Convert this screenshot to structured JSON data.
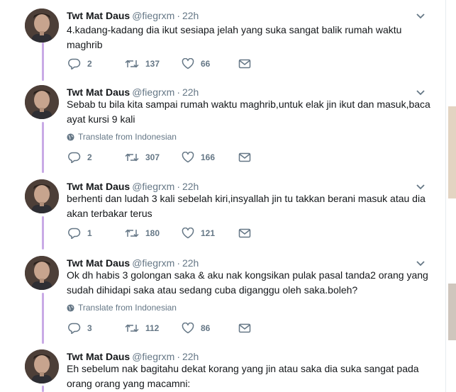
{
  "tweets": [
    {
      "name": "Twt Mat Daus",
      "handle": "@fiegrxm",
      "time": "22h",
      "dot": "·",
      "text": "4.kadang-kadang dia ikut sesiapa jelah yang suka sangat balik rumah waktu maghrib",
      "translate": "",
      "replies": "2",
      "retweets": "137",
      "likes": "66"
    },
    {
      "name": "Twt Mat Daus",
      "handle": "@fiegrxm",
      "time": "22h",
      "dot": "·",
      "text": "Sebab tu bila kita sampai rumah waktu maghrib,untuk elak jin ikut dan masuk,baca ayat kursi 9 kali",
      "translate": "Translate from Indonesian",
      "replies": "2",
      "retweets": "307",
      "likes": "166"
    },
    {
      "name": "Twt Mat Daus",
      "handle": "@fiegrxm",
      "time": "22h",
      "dot": "·",
      "text": "berhenti dan ludah 3 kali sebelah kiri,insyallah jin tu takkan berani masuk atau dia akan terbakar terus",
      "translate": "",
      "replies": "1",
      "retweets": "180",
      "likes": "121"
    },
    {
      "name": "Twt Mat Daus",
      "handle": "@fiegrxm",
      "time": "22h",
      "dot": "·",
      "text": "Ok dh habis 3 golongan saka & aku nak kongsikan pulak pasal tanda2 orang yang sudah dihidapi saka atau sedang cuba diganggu oleh saka.boleh?",
      "translate": "Translate from Indonesian",
      "replies": "3",
      "retweets": "112",
      "likes": "86"
    },
    {
      "name": "Twt Mat Daus",
      "handle": "@fiegrxm",
      "time": "22h",
      "dot": "·",
      "text": "Eh sebelum nak bagitahu dekat korang yang jin atau saka dia suka sangat pada orang orang yang macamni:",
      "translate": "",
      "replies": "",
      "retweets": "",
      "likes": ""
    }
  ],
  "colors": {
    "thread_line": "#c9aae6",
    "muted": "#657786",
    "text": "#14171a"
  },
  "icons": [
    "reply-icon",
    "retweet-icon",
    "like-icon",
    "direct-message-icon",
    "chevron-down-icon",
    "globe-icon"
  ]
}
